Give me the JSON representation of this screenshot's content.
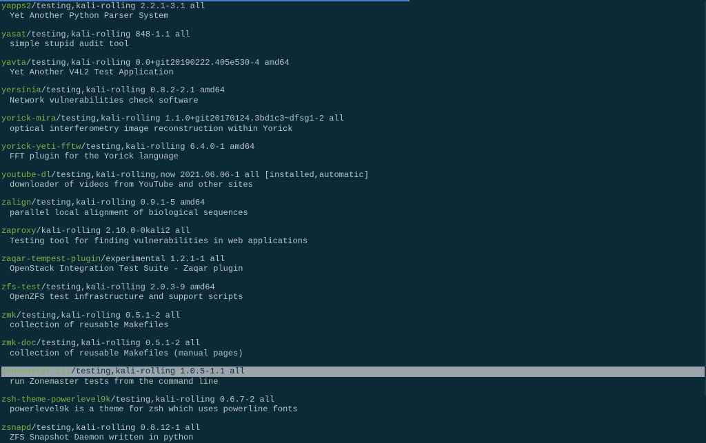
{
  "packages": [
    {
      "name": "yapps2",
      "meta": "/testing,kali-rolling 2.2.1-3.1 all",
      "desc": "Yet Another Python Parser System"
    },
    {
      "name": "yasat",
      "meta": "/testing,kali-rolling 848-1.1 all",
      "desc": "simple stupid audit tool"
    },
    {
      "name": "yavta",
      "meta": "/testing,kali-rolling 0.0+git20190222.405e530-4 amd64",
      "desc": "Yet Another V4L2 Test Application"
    },
    {
      "name": "yersinia",
      "meta": "/testing,kali-rolling 0.8.2-2.1 amd64",
      "desc": "Network vulnerabilities check software"
    },
    {
      "name": "yorick-mira",
      "meta": "/testing,kali-rolling 1.1.0+git20170124.3bd1c3~dfsg1-2 all",
      "desc": "optical interferometry image reconstruction within Yorick"
    },
    {
      "name": "yorick-yeti-fftw",
      "meta": "/testing,kali-rolling 6.4.0-1 amd64",
      "desc": "FFT plugin for the Yorick language"
    },
    {
      "name": "youtube-dl",
      "meta": "/testing,kali-rolling,now 2021.06.06-1 all [installed,automatic]",
      "desc": "downloader of videos from YouTube and other sites"
    },
    {
      "name": "zalign",
      "meta": "/testing,kali-rolling 0.9.1-5 amd64",
      "desc": "parallel local alignment of biological sequences"
    },
    {
      "name": "zaproxy",
      "meta": "/kali-rolling 2.10.0-0kali2 all",
      "desc": "Testing tool for finding vulnerabilities in web applications"
    },
    {
      "name": "zaqar-tempest-plugin",
      "meta": "/experimental 1.2.1-1 all",
      "desc": "OpenStack Integration Test Suite - Zaqar plugin"
    },
    {
      "name": "zfs-test",
      "meta": "/testing,kali-rolling 2.0.3-9 amd64",
      "desc": "OpenZFS test infrastructure and support scripts"
    },
    {
      "name": "zmk",
      "meta": "/testing,kali-rolling 0.5.1-2 all",
      "desc": "collection of reusable Makefiles"
    },
    {
      "name": "zmk-doc",
      "meta": "/testing,kali-rolling 0.5.1-2 all",
      "desc": "collection of reusable Makefiles (manual pages)"
    },
    {
      "name": "zonemaster-cli",
      "meta": "/testing,kali-rolling 1.0.5-1.1 all",
      "desc": "run Zonemaster tests from the command line",
      "highlighted": true
    },
    {
      "name": "zsh-theme-powerlevel9k",
      "meta": "/testing,kali-rolling 0.6.7-2 all",
      "desc": "powerlevel9k is a theme for zsh which uses powerline fonts"
    },
    {
      "name": "zsnapd",
      "meta": "/testing,kali-rolling 0.8.12-1 all",
      "desc": "ZFS Snapshot Daemon written in python"
    }
  ]
}
